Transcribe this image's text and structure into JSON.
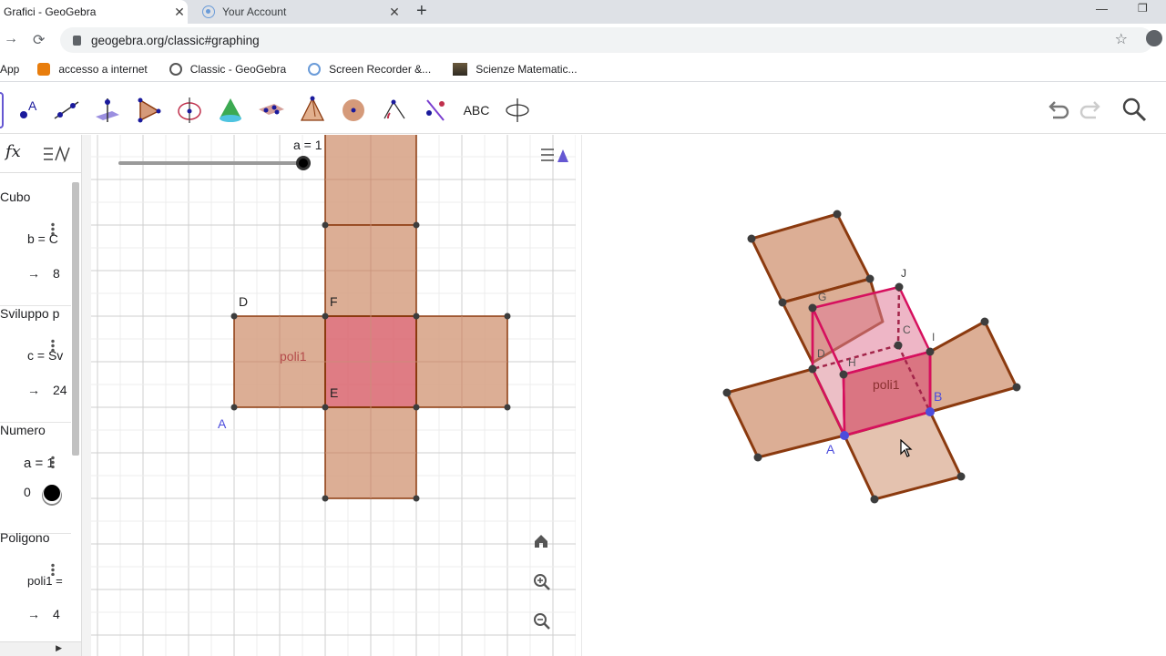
{
  "browser": {
    "tabs": [
      {
        "title": "Grafici - GeoGebra",
        "active": true
      },
      {
        "title": "Your Account",
        "active": false
      }
    ],
    "url": "geogebra.org/classic#graphing",
    "bookmarks": [
      {
        "label": "App",
        "icon": "apps-icon"
      },
      {
        "label": "accesso a internet",
        "icon": "lock-icon"
      },
      {
        "label": "Classic - GeoGebra",
        "icon": "geogebra-icon"
      },
      {
        "label": "Screen Recorder &...",
        "icon": "recorder-icon"
      },
      {
        "label": "Scienze Matematic...",
        "icon": "image-icon"
      }
    ]
  },
  "toolbar": {
    "tools": [
      "move",
      "point",
      "line",
      "perpendicular",
      "polygon",
      "circle",
      "sphere",
      "plane",
      "pyramid",
      "intersect",
      "angle",
      "reflect",
      "text",
      "rotate-view"
    ],
    "text_tool_label": "ABC"
  },
  "algebra": {
    "fx_label": "fx",
    "groups": [
      {
        "category": "Cubo",
        "def": "b = C",
        "result": "8"
      },
      {
        "category": "Sviluppo p",
        "def": "c = Sv",
        "result": "24"
      },
      {
        "category": "Numero",
        "def": "a = 1",
        "result": "0"
      },
      {
        "category": "Poligono",
        "def": "poli1 =",
        "result": "4"
      }
    ],
    "arrow": "→"
  },
  "graphics2d": {
    "slider_label": "a = 1",
    "slider_value": 1,
    "point_labels": {
      "D": "D",
      "F": "F",
      "E": "E",
      "A": "A"
    },
    "polygon_label": "poli1"
  },
  "graphics3d": {
    "point_labels": {
      "J": "J",
      "G": "G",
      "C": "C",
      "I": "I",
      "D": "D",
      "H": "H",
      "A": "A",
      "B": "B"
    },
    "polygon_label": "poli1"
  },
  "colors": {
    "face_fill": "#d8a58a",
    "face_edge": "#8b3a0f",
    "base_fill": "#d9656e",
    "cube_edge": "#d6105e",
    "point": "#3d3d3d",
    "blue_point": "#4c4cdc"
  }
}
